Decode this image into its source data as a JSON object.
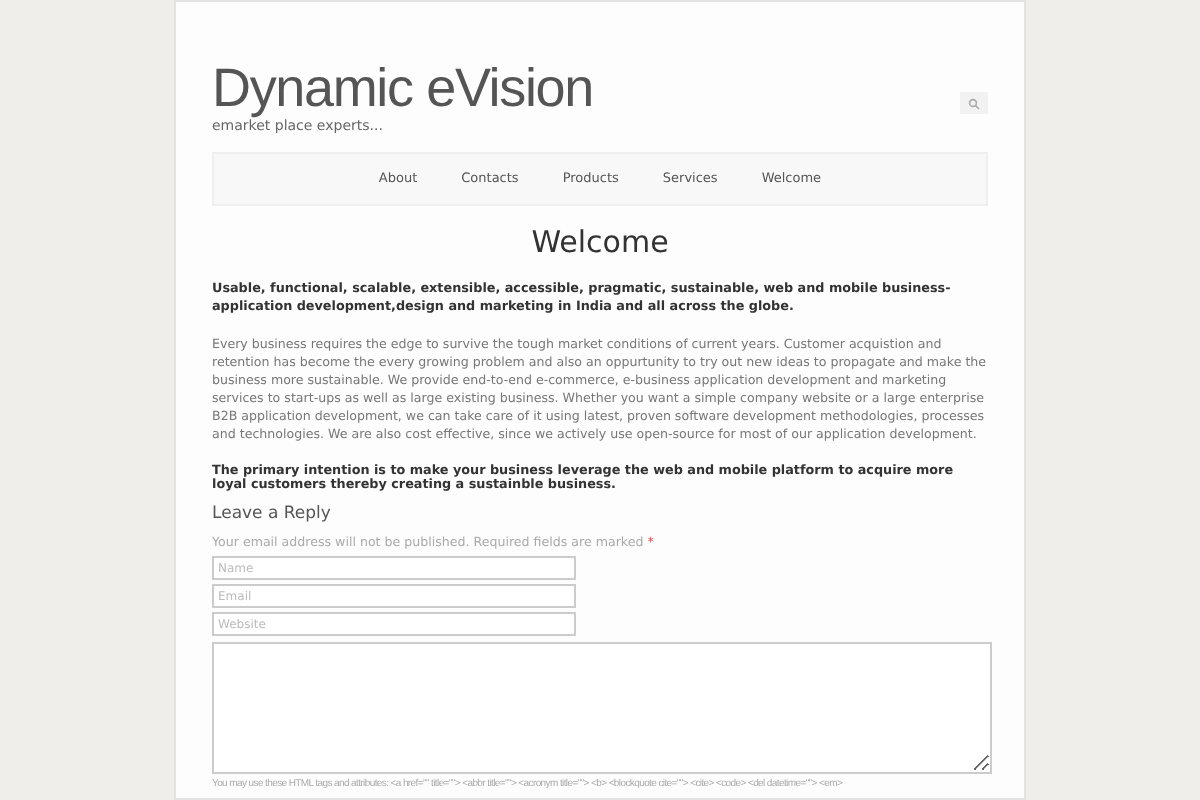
{
  "site": {
    "title": "Dynamic eVision",
    "tagline": "emarket place experts..."
  },
  "nav": [
    {
      "label": "About"
    },
    {
      "label": "Contacts"
    },
    {
      "label": "Products"
    },
    {
      "label": "Services"
    },
    {
      "label": "Welcome"
    }
  ],
  "page_title": "Welcome",
  "intro": "Usable, functional, scalable, extensible, accessible, pragmatic, sustainable, web and mobile business-application development,design and marketing in India and all across the globe.",
  "body": "Every business requires the edge to survive the tough market conditions of current years. Customer acquistion and retention has become the every growing problem and also an oppurtunity to try out new ideas to propagate and make the business more sustainable. We provide end-to-end e-commerce, e-business application development and marketing services to start-ups as well as large existing business. Whether you want a simple company website or a large enterprise B2B application development, we can take care of it using latest, proven software development methodologies, processes and technologies. We are also cost effective, since we actively use open-source for most of our application development.",
  "closing": "The primary intention is to make your business leverage the web and mobile platform to acquire more loyal customers thereby creating a sustainble business.",
  "reply": {
    "heading": "Leave a Reply",
    "note": "Your email address will not be published. Required fields are marked",
    "required_mark": "*",
    "fields": [
      {
        "placeholder": "Name"
      },
      {
        "placeholder": "Email"
      },
      {
        "placeholder": "Website"
      }
    ],
    "allowed_tags": "You may use these HTML tags and attributes: <a href=\"\" title=\"\"> <abbr title=\"\"> <acronym title=\"\"> <b> <blockquote cite=\"\"> <cite> <code> <del datetime=\"\"> <em>"
  }
}
